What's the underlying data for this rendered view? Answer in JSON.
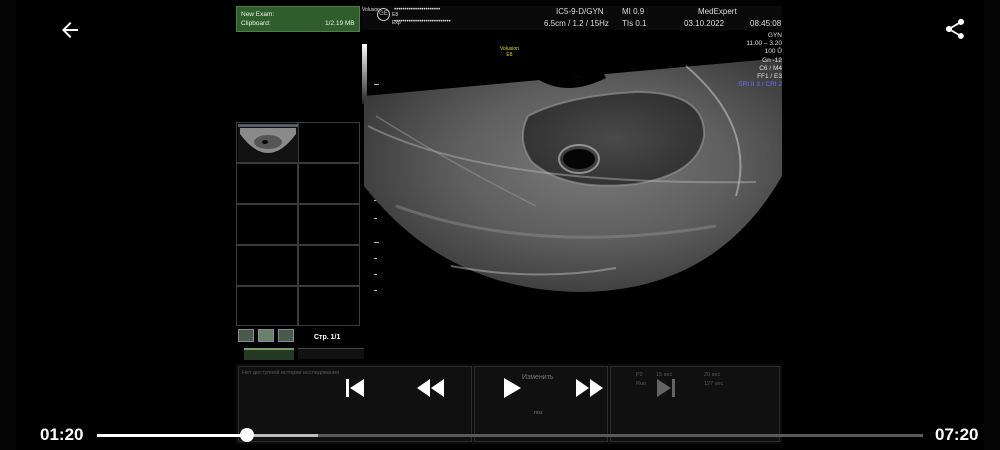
{
  "player": {
    "current_time": "01:20",
    "total_time": "07:20",
    "progress_fraction": 0.182,
    "buffered_fraction": 0.268
  },
  "ultrasound": {
    "exam": {
      "title": "New Exam:",
      "clipboard_label": "Clipboard:",
      "clipboard_size": "1/2.19 MB"
    },
    "header": {
      "brand": "Voluson",
      "brand_sup": "E8",
      "mode": "Exp",
      "masked_1": "••••••••••••••••••••••",
      "masked_2": "•••••••••••••••••••••••••••",
      "probe": "IC5-9-D/GYN",
      "mi": "MI  0.9",
      "depth_freq": "6.5cm / 1.2 / 15Hz",
      "tis": "TIs  0.1",
      "date": "03.10.2022",
      "time": "08:45:08",
      "institution": "MedExpert"
    },
    "params": [
      "GYN",
      "11.00 – 3.20",
      "100 Ů",
      "Gn -12",
      "C6 / M4",
      "FF1 / E3",
      "SRI II 3 / CRI 2"
    ],
    "volume_mark": [
      "Volusion",
      "E8"
    ],
    "page": "Стр. 1/1",
    "tabs": [
      "История",
      "Измерение в/и"
    ],
    "history_text": "Нет доступной истории исследования",
    "center_btn": "Изменить",
    "center_btn_sub": "поз",
    "right_panel": [
      "P2",
      "15 sec",
      "Run",
      "20 sec",
      "127 sec"
    ]
  }
}
